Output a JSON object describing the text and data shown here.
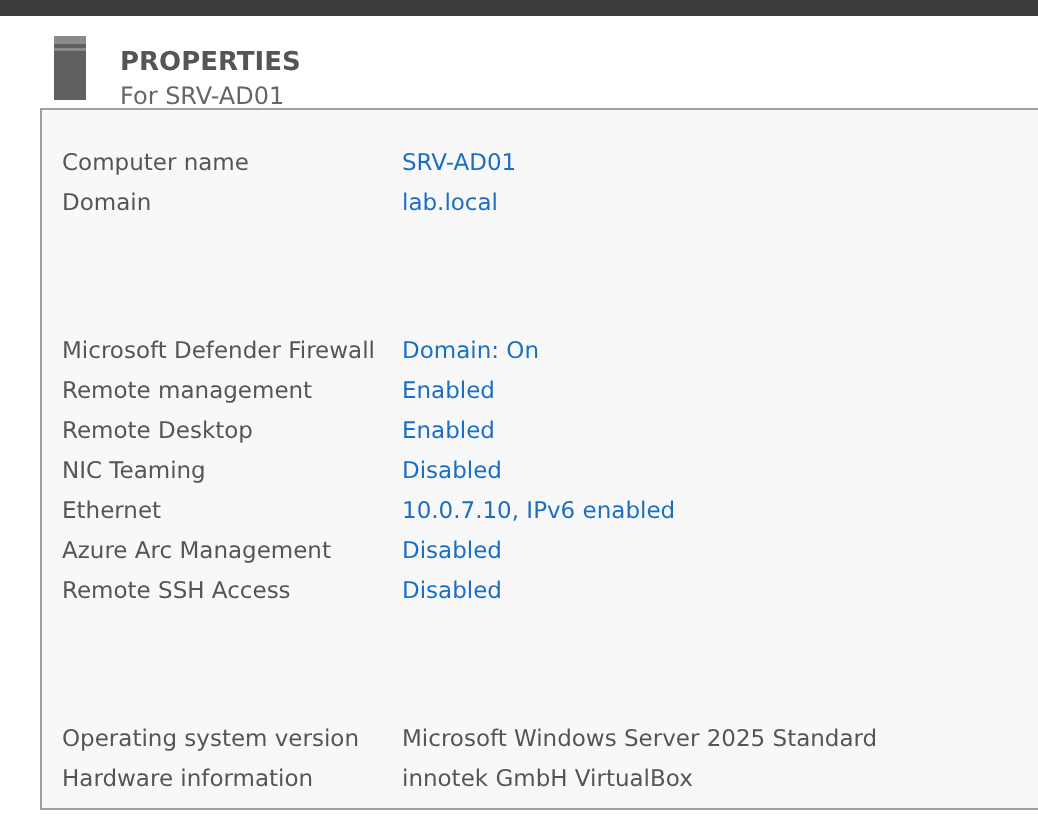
{
  "header": {
    "title": "PROPERTIES",
    "subtitle": "For SRV-AD01"
  },
  "sections": [
    {
      "rows": [
        {
          "label": "Computer name",
          "value": "SRV-AD01",
          "kind": "link"
        },
        {
          "label": "Domain",
          "value": "lab.local",
          "kind": "link"
        }
      ]
    },
    {
      "rows": [
        {
          "label": "Microsoft Defender Firewall",
          "value": "Domain: On",
          "kind": "link"
        },
        {
          "label": "Remote management",
          "value": "Enabled",
          "kind": "link"
        },
        {
          "label": "Remote Desktop",
          "value": "Enabled",
          "kind": "link"
        },
        {
          "label": "NIC Teaming",
          "value": "Disabled",
          "kind": "link"
        },
        {
          "label": "Ethernet",
          "value": "10.0.7.10, IPv6 enabled",
          "kind": "link"
        },
        {
          "label": "Azure Arc Management",
          "value": "Disabled",
          "kind": "link"
        },
        {
          "label": "Remote SSH Access",
          "value": "Disabled",
          "kind": "link"
        }
      ]
    },
    {
      "rows": [
        {
          "label": "Operating system version",
          "value": "Microsoft Windows Server 2025 Standard",
          "kind": "text"
        },
        {
          "label": "Hardware information",
          "value": "innotek GmbH VirtualBox",
          "kind": "text"
        }
      ]
    }
  ]
}
